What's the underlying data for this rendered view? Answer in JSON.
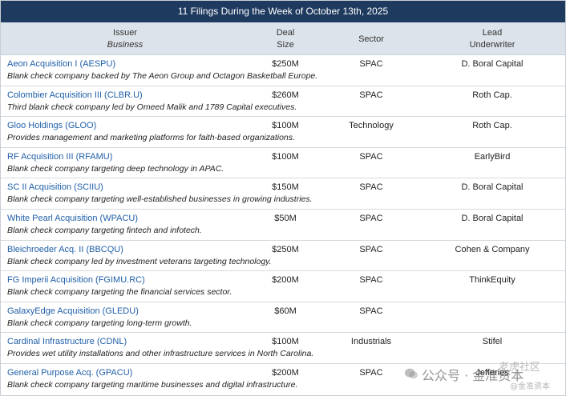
{
  "title": "11 Filings During the Week of October 13th, 2025",
  "header": {
    "issuer": "Issuer",
    "business": "Business",
    "deal_line1": "Deal",
    "deal_line2": "Size",
    "sector": "Sector",
    "lead_line1": "Lead",
    "lead_line2": "Underwriter"
  },
  "rows": [
    {
      "issuer": "Aeon Acquisition I (AESPU)",
      "desc": "Blank check company backed by The Aeon Group and Octagon Basketball Europe.",
      "deal": "$250M",
      "sector": "SPAC",
      "underwriter": "D. Boral Capital"
    },
    {
      "issuer": "Colombier Acquisition III (CLBR.U)",
      "desc": "Third blank check company led by Omeed Malik and 1789 Capital executives.",
      "deal": "$260M",
      "sector": "SPAC",
      "underwriter": "Roth Cap."
    },
    {
      "issuer": "Gloo Holdings (GLOO)",
      "desc": "Provides management and marketing platforms for faith-based organizations.",
      "deal": "$100M",
      "sector": "Technology",
      "underwriter": "Roth Cap."
    },
    {
      "issuer": "RF Acquisition III (RFAMU)",
      "desc": "Blank check company targeting deep technology in APAC.",
      "deal": "$100M",
      "sector": "SPAC",
      "underwriter": "EarlyBird"
    },
    {
      "issuer": "SC II Acquisition (SCIIU)",
      "desc": "Blank check company targeting well-established businesses in growing industries.",
      "deal": "$150M",
      "sector": "SPAC",
      "underwriter": "D. Boral Capital"
    },
    {
      "issuer": "White Pearl Acquisition (WPACU)",
      "desc": "Blank check company targeting fintech and infotech.",
      "deal": "$50M",
      "sector": "SPAC",
      "underwriter": "D. Boral Capital"
    },
    {
      "issuer": "Bleichroeder Acq. II (BBCQU)",
      "desc": "Blank check company led by investment veterans targeting technology.",
      "deal": "$250M",
      "sector": "SPAC",
      "underwriter": "Cohen & Company"
    },
    {
      "issuer": "FG Imperii Acquisition (FGIMU.RC)",
      "desc": "Blank check company targeting the financial services sector.",
      "deal": "$200M",
      "sector": "SPAC",
      "underwriter": "ThinkEquity"
    },
    {
      "issuer": "GalaxyEdge Acquisition (GLEDU)",
      "desc": "Blank check company targeting long-term growth.",
      "deal": "$60M",
      "sector": "SPAC",
      "underwriter": ""
    },
    {
      "issuer": "Cardinal Infrastructure (CDNL)",
      "desc": "Provides wet utility installations and other infrastructure services in North Carolina.",
      "deal": "$100M",
      "sector": "Industrials",
      "underwriter": "Stifel"
    },
    {
      "issuer": "General Purpose Acq. (GPACU)",
      "desc": "Blank check company targeting maritime businesses and digital infrastructure.",
      "deal": "$200M",
      "sector": "SPAC",
      "underwriter": "Jefferies"
    }
  ],
  "watermark": {
    "main": "公众号 · 金准资本",
    "top": "老虎社区",
    "bottom": "@金准资本"
  }
}
